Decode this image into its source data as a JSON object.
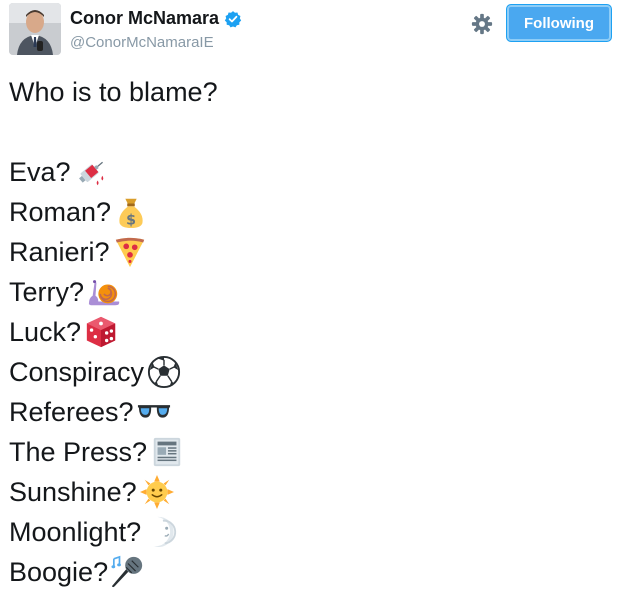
{
  "author": {
    "name": "Conor McNamara",
    "handle": "@ConorMcNamaraIE"
  },
  "follow_button": {
    "label": "Following"
  },
  "tweet": {
    "headline": "Who is to blame?",
    "lines": [
      {
        "text": "Eva?",
        "emoji": "syringe-icon"
      },
      {
        "text": "Roman?",
        "emoji": "money-bag-icon"
      },
      {
        "text": "Ranieri?",
        "emoji": "pizza-icon"
      },
      {
        "text": "Terry?",
        "emoji": "snail-icon"
      },
      {
        "text": "Luck?",
        "emoji": "dice-icon"
      },
      {
        "text": "Conspiracy",
        "emoji": "soccer-ball-icon"
      },
      {
        "text": "Referees?",
        "emoji": "glasses-icon"
      },
      {
        "text": "The Press?",
        "emoji": "newspaper-icon"
      },
      {
        "text": "Sunshine?",
        "emoji": "sun-face-icon"
      },
      {
        "text": "Moonlight?",
        "emoji": "crescent-moon-icon"
      },
      {
        "text": "Boogie?",
        "emoji": "microphone-icon"
      }
    ]
  },
  "colors": {
    "accent": "#1da1f2",
    "text": "#14171a",
    "muted": "#8899a6"
  }
}
